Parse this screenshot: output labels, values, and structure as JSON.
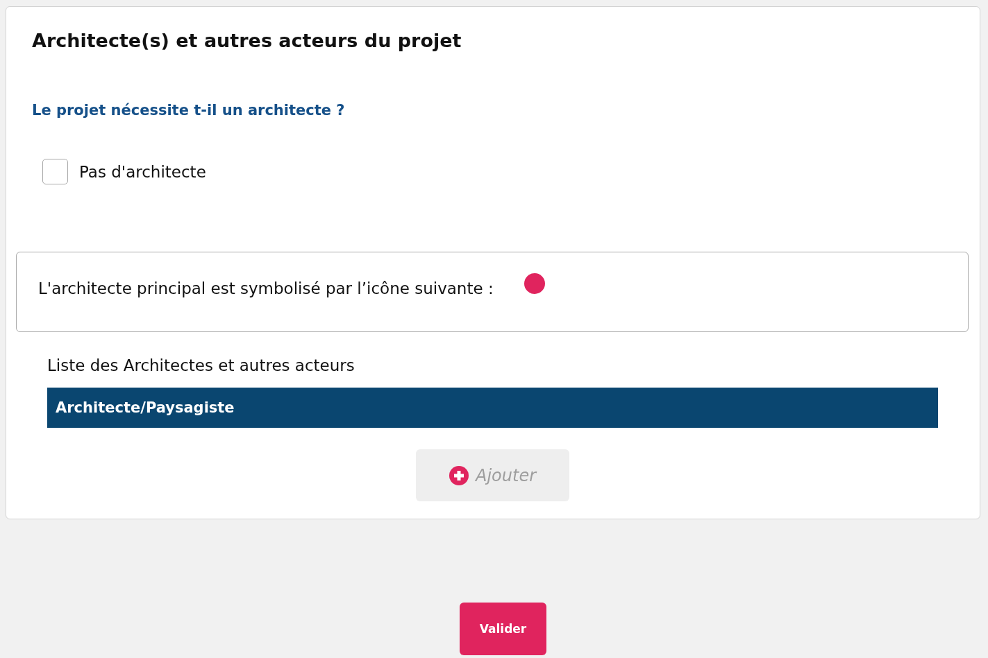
{
  "title": "Architecte(s) et autres acteurs du projet",
  "question": "Le projet nécessite t-il un architecte ?",
  "options": [
    {
      "label": "Pas d'architecte",
      "checked": false
    }
  ],
  "info": {
    "text": "L'architecte principal est symbolisé par l’icône suivante :"
  },
  "list": {
    "heading": "Liste des Architectes et autres acteurs",
    "table": {
      "columns": [
        "Architecte/Paysagiste"
      ]
    },
    "add_button": {
      "label": "Ajouter",
      "disabled": true
    }
  },
  "submit_button": {
    "label": "Valider"
  }
}
